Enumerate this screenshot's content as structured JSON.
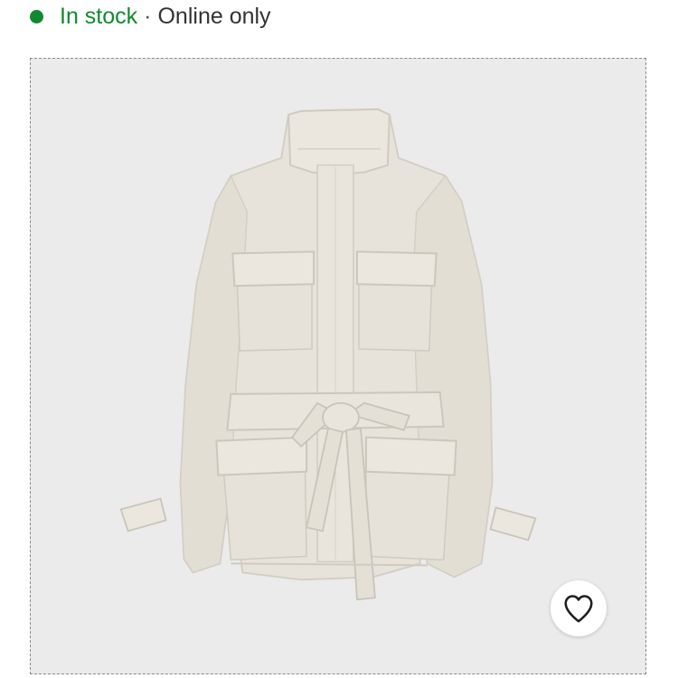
{
  "availability": {
    "status": "In stock",
    "separator": "·",
    "channel": "Online only",
    "status_color": "#118a2f"
  },
  "product": {
    "image_background": "#ebebeb",
    "garment_color": "#e7e3da"
  },
  "favorite": {
    "icon": "heart-outline-icon"
  }
}
